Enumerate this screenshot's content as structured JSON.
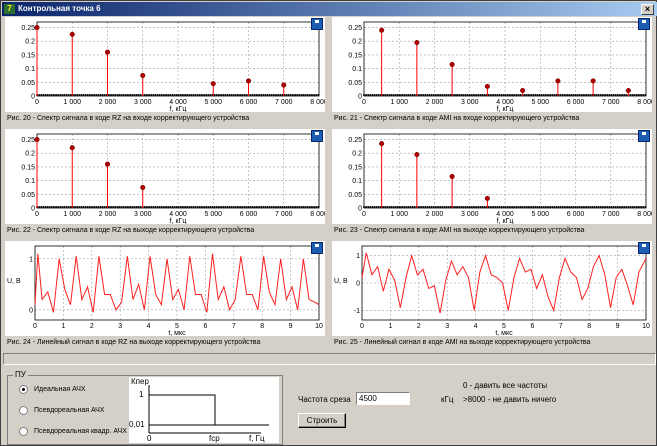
{
  "window": {
    "title": "Контрольная точка 6",
    "app_icon": "7",
    "close": "×"
  },
  "panels": [
    {
      "id": "rz-in",
      "caption": "Рис. 20 - Спектр сигнала в коде RZ на входе корректирующего устройства",
      "xlabel": "f, кГц",
      "ylabel": "",
      "chart_data": {
        "type": "scatter",
        "title": "",
        "xlabel": "f, кГц",
        "ylabel": "",
        "xlim": [
          0,
          8000
        ],
        "ylim": [
          0,
          0.27
        ],
        "xticks": [
          "0",
          "1 000",
          "2 000",
          "3 000",
          "4 000",
          "5 000",
          "6 000",
          "7 000",
          "8 000"
        ],
        "yticks": [
          "0",
          "0.05",
          "0.1",
          "0.15",
          "0.2",
          "0.25"
        ],
        "x": [
          0,
          1000,
          2000,
          3000,
          5000,
          6000,
          7000
        ],
        "y": [
          0.25,
          0.225,
          0.16,
          0.075,
          0.045,
          0.055,
          0.04
        ]
      }
    },
    {
      "id": "ami-in",
      "caption": "Рис. 21 - Спектр сигнала в коде AMI на входе корректирующего устройства",
      "xlabel": "f, кГц",
      "ylabel": "",
      "chart_data": {
        "type": "scatter",
        "title": "",
        "xlabel": "f, кГц",
        "ylabel": "",
        "xlim": [
          0,
          8000
        ],
        "ylim": [
          0,
          0.27
        ],
        "xticks": [
          "0",
          "1 000",
          "2 000",
          "3 000",
          "4 000",
          "5 000",
          "6 000",
          "7 000",
          "8 000"
        ],
        "yticks": [
          "0",
          "0.05",
          "0.1",
          "0.15",
          "0.2",
          "0.25"
        ],
        "x": [
          500,
          1500,
          2500,
          3500,
          4500,
          5500,
          6500,
          7500
        ],
        "y": [
          0.24,
          0.195,
          0.115,
          0.035,
          0.02,
          0.055,
          0.055,
          0.02
        ]
      }
    },
    {
      "id": "rz-out",
      "caption": "Рис. 22 - Спектр сигнала в коде RZ на выходе корректирующего устройства",
      "xlabel": "f, кГц",
      "ylabel": "",
      "chart_data": {
        "type": "scatter",
        "title": "",
        "xlabel": "f, кГц",
        "ylabel": "",
        "xlim": [
          0,
          8000
        ],
        "ylim": [
          0,
          0.27
        ],
        "xticks": [
          "0",
          "1 000",
          "2 000",
          "3 000",
          "4 000",
          "5 000",
          "6 000",
          "7 000",
          "8 000"
        ],
        "yticks": [
          "0",
          "0.05",
          "0.1",
          "0.15",
          "0.2",
          "0.25"
        ],
        "x": [
          0,
          1000,
          2000,
          3000
        ],
        "y": [
          0.25,
          0.22,
          0.16,
          0.075
        ]
      }
    },
    {
      "id": "ami-out",
      "caption": "Рис. 23 - Спектр сигнала в коде AMI на выходе корректирующего устройства",
      "xlabel": "f, кГц",
      "ylabel": "",
      "chart_data": {
        "type": "scatter",
        "title": "",
        "xlabel": "f, кГц",
        "ylabel": "",
        "xlim": [
          0,
          8000
        ],
        "ylim": [
          0,
          0.27
        ],
        "xticks": [
          "0",
          "1 000",
          "2 000",
          "3 000",
          "4 000",
          "5 000",
          "6 000",
          "7 000",
          "8 000"
        ],
        "yticks": [
          "0",
          "0.05",
          "0.1",
          "0.15",
          "0.2",
          "0.25"
        ],
        "x": [
          500,
          1500,
          2500,
          3500
        ],
        "y": [
          0.235,
          0.195,
          0.115,
          0.035
        ]
      }
    },
    {
      "id": "rz-sig",
      "caption": "Рис. 24 - Линейный сигнал в коде RZ на выходе корректирующего устройства",
      "xlabel": "t, мкс",
      "ylabel": "U, В",
      "chart_data": {
        "type": "line",
        "title": "",
        "xlabel": "t, мкс",
        "ylabel": "U, В",
        "xlim": [
          0,
          10
        ],
        "ylim": [
          -0.2,
          1.25
        ],
        "xticks": [
          "0",
          "1",
          "2",
          "3",
          "4",
          "5",
          "6",
          "7",
          "8",
          "9",
          "10"
        ],
        "yticks": [
          "0",
          "1"
        ],
        "x": [
          0,
          0.1,
          0.25,
          0.45,
          0.65,
          0.85,
          1.05,
          1.25,
          1.45,
          1.65,
          1.85,
          2.05,
          2.25,
          2.45,
          2.65,
          2.85,
          3.05,
          3.25,
          3.45,
          3.65,
          3.85,
          4.05,
          4.25,
          4.45,
          4.65,
          4.85,
          5.05,
          5.25,
          5.45,
          5.65,
          5.85,
          6.05,
          6.25,
          6.45,
          6.65,
          6.85,
          7.05,
          7.25,
          7.45,
          7.65,
          7.85,
          8.05,
          8.25,
          8.45,
          8.65,
          8.85,
          9.05,
          9.25,
          9.45,
          9.65,
          9.85,
          10
        ],
        "y": [
          0.1,
          1.1,
          0.2,
          0.35,
          -0.05,
          1.0,
          0.4,
          0.1,
          1.05,
          0.2,
          0.45,
          -0.05,
          1.05,
          0.3,
          0.3,
          0.0,
          0.15,
          1.05,
          0.2,
          0.5,
          0.0,
          1.05,
          0.3,
          0.1,
          1.0,
          0.2,
          0.4,
          0.0,
          1.05,
          0.3,
          0.3,
          -0.05,
          1.1,
          0.2,
          0.45,
          0.0,
          0.2,
          1.05,
          0.3,
          0.3,
          0.0,
          1.05,
          0.35,
          0.1,
          1.0,
          0.2,
          0.45,
          0.0,
          1.0,
          0.2,
          0.15,
          0.1
        ]
      }
    },
    {
      "id": "ami-sig",
      "caption": "Рис. 25 - Линейный сигнал в коде AMI на выходе корректирующего устройства",
      "xlabel": "t, мкс",
      "ylabel": "U, В",
      "chart_data": {
        "type": "line",
        "title": "",
        "xlabel": "t, мкс",
        "ylabel": "U, В",
        "xlim": [
          0,
          10
        ],
        "ylim": [
          -1.35,
          1.35
        ],
        "xticks": [
          "0",
          "1",
          "2",
          "3",
          "4",
          "5",
          "6",
          "7",
          "8",
          "9",
          "10"
        ],
        "yticks": [
          "-1",
          "0",
          "1"
        ],
        "x": [
          0,
          0.15,
          0.35,
          0.55,
          0.75,
          0.95,
          1.15,
          1.35,
          1.55,
          1.75,
          1.95,
          2.15,
          2.35,
          2.55,
          2.75,
          2.95,
          3.15,
          3.35,
          3.55,
          3.75,
          3.95,
          4.15,
          4.35,
          4.55,
          4.75,
          4.95,
          5.15,
          5.35,
          5.55,
          5.75,
          5.95,
          6.15,
          6.35,
          6.55,
          6.75,
          6.95,
          7.15,
          7.35,
          7.55,
          7.75,
          7.95,
          8.15,
          8.35,
          8.55,
          8.75,
          8.95,
          9.15,
          9.35,
          9.55,
          9.75,
          10
        ],
        "y": [
          0.2,
          1.1,
          0.3,
          0.6,
          -0.3,
          0.5,
          0.1,
          -0.9,
          0.2,
          1.0,
          0.3,
          0.5,
          -0.2,
          -0.1,
          -1.1,
          0.1,
          0.8,
          0.3,
          0.6,
          0.2,
          -1.0,
          0.4,
          1.0,
          0.3,
          0.2,
          0.0,
          -1.0,
          0.2,
          0.9,
          0.4,
          0.5,
          -0.2,
          0.3,
          -0.5,
          -1.0,
          0.2,
          0.9,
          0.4,
          0.2,
          -0.6,
          -0.2,
          0.6,
          1.0,
          0.3,
          -0.9,
          0.2,
          0.5,
          -0.1,
          -0.8,
          0.4,
          0.9
        ]
      }
    }
  ],
  "controls": {
    "group_label": "ПУ",
    "radios": [
      {
        "label": "Идеальная АЧХ",
        "selected": true
      },
      {
        "label": "Псевдореальная АЧХ",
        "selected": false
      },
      {
        "label": "Псевдореальная квадр. АЧХ",
        "selected": false
      }
    ],
    "diagram": {
      "ylabel": "Кпер",
      "y1": "1",
      "y2": "0,01",
      "x0": "0",
      "xc": "fср",
      "xlabel": "f, Гц"
    },
    "cutoff_label": "Частота среза",
    "cutoff_value": "4500",
    "cutoff_unit": "кГц",
    "hint1": "0 - давить все частоты",
    "hint2": ">8000 - не давить ничего",
    "build": "Строить"
  },
  "colors": {
    "stem": "#ff0000",
    "marker": "#b00000",
    "signal": "#ff2020",
    "grid": "#a0a0a0",
    "noise": "#000000"
  }
}
